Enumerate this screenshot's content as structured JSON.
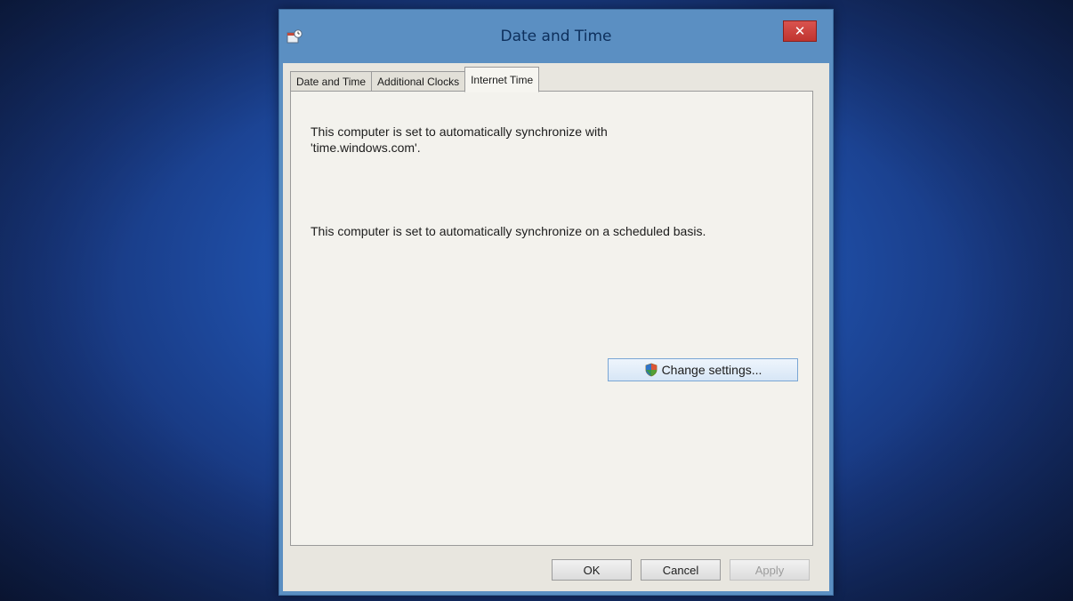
{
  "window": {
    "title": "Date and Time",
    "icon": "clock-calendar-icon",
    "close_icon": "close-icon"
  },
  "tabs": [
    {
      "label": "Date and Time",
      "active": false
    },
    {
      "label": "Additional Clocks",
      "active": false
    },
    {
      "label": "Internet Time",
      "active": true
    }
  ],
  "internet_time": {
    "sync_server_message": "This computer is set to automatically synchronize with 'time.windows.com'.",
    "schedule_message": "This computer is set to automatically synchronize on a scheduled basis.",
    "change_settings_label": "Change settings...",
    "change_settings_icon": "uac-shield-icon"
  },
  "buttons": {
    "ok": "OK",
    "cancel": "Cancel",
    "apply": "Apply"
  },
  "colors": {
    "frame": "#5b8fc2",
    "title_text": "#0d2f5c",
    "close_button": "#c9403b",
    "client_bg": "#e8e6df",
    "desktop": "#1f4fa8"
  }
}
